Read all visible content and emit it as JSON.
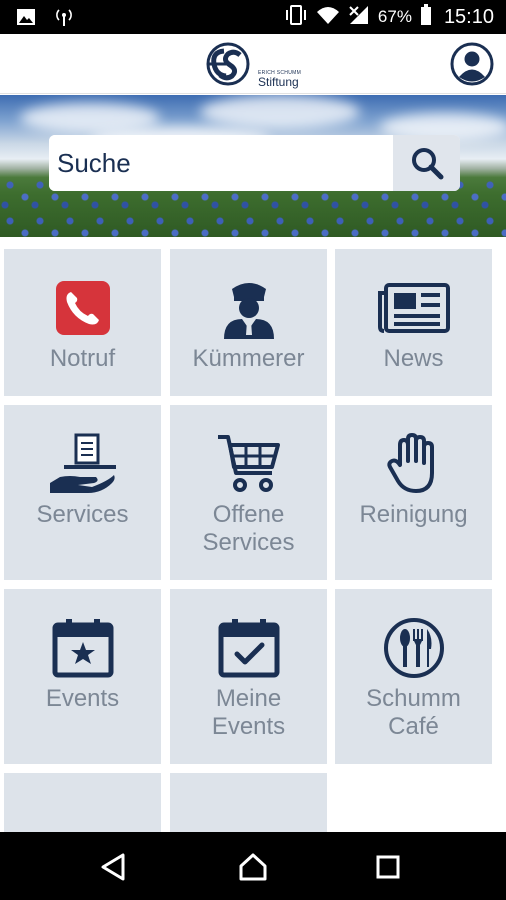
{
  "status_bar": {
    "battery_percent": "67%",
    "time": "15:10",
    "icons": [
      "image-icon",
      "radio-signal-icon",
      "vibrate-icon",
      "wifi-icon",
      "cell-signal-icon",
      "battery-icon"
    ]
  },
  "header": {
    "logo_text_small": "ERICH SCHUMM",
    "logo_text": "Stiftung",
    "avatar_icon": "profile-icon"
  },
  "search": {
    "placeholder": "Suche",
    "button_icon": "search-icon"
  },
  "colors": {
    "brand_navy": "#1a2f52",
    "tile_bg": "#dde3ea",
    "tile_label": "#7c8795",
    "emergency_red": "#d6343b"
  },
  "tiles": [
    {
      "label": "Notruf",
      "icon": "phone-icon"
    },
    {
      "label": "Kümmerer",
      "icon": "concierge-icon"
    },
    {
      "label": "News",
      "icon": "newspaper-icon"
    },
    {
      "label": "Services",
      "icon": "service-tray-icon"
    },
    {
      "label_line1": "Offene",
      "label_line2": "Services",
      "icon": "shopping-cart-icon"
    },
    {
      "label": "Reinigung",
      "icon": "hand-icon"
    },
    {
      "label": "Events",
      "icon": "calendar-star-icon"
    },
    {
      "label_line1": "Meine",
      "label_line2": "Events",
      "icon": "calendar-check-icon"
    },
    {
      "label_line1": "Schumm",
      "label_line2": "Café",
      "icon": "cafe-cutlery-icon"
    }
  ],
  "nav": {
    "back_icon": "back-icon",
    "home_icon": "home-icon",
    "recents_icon": "recents-icon"
  }
}
